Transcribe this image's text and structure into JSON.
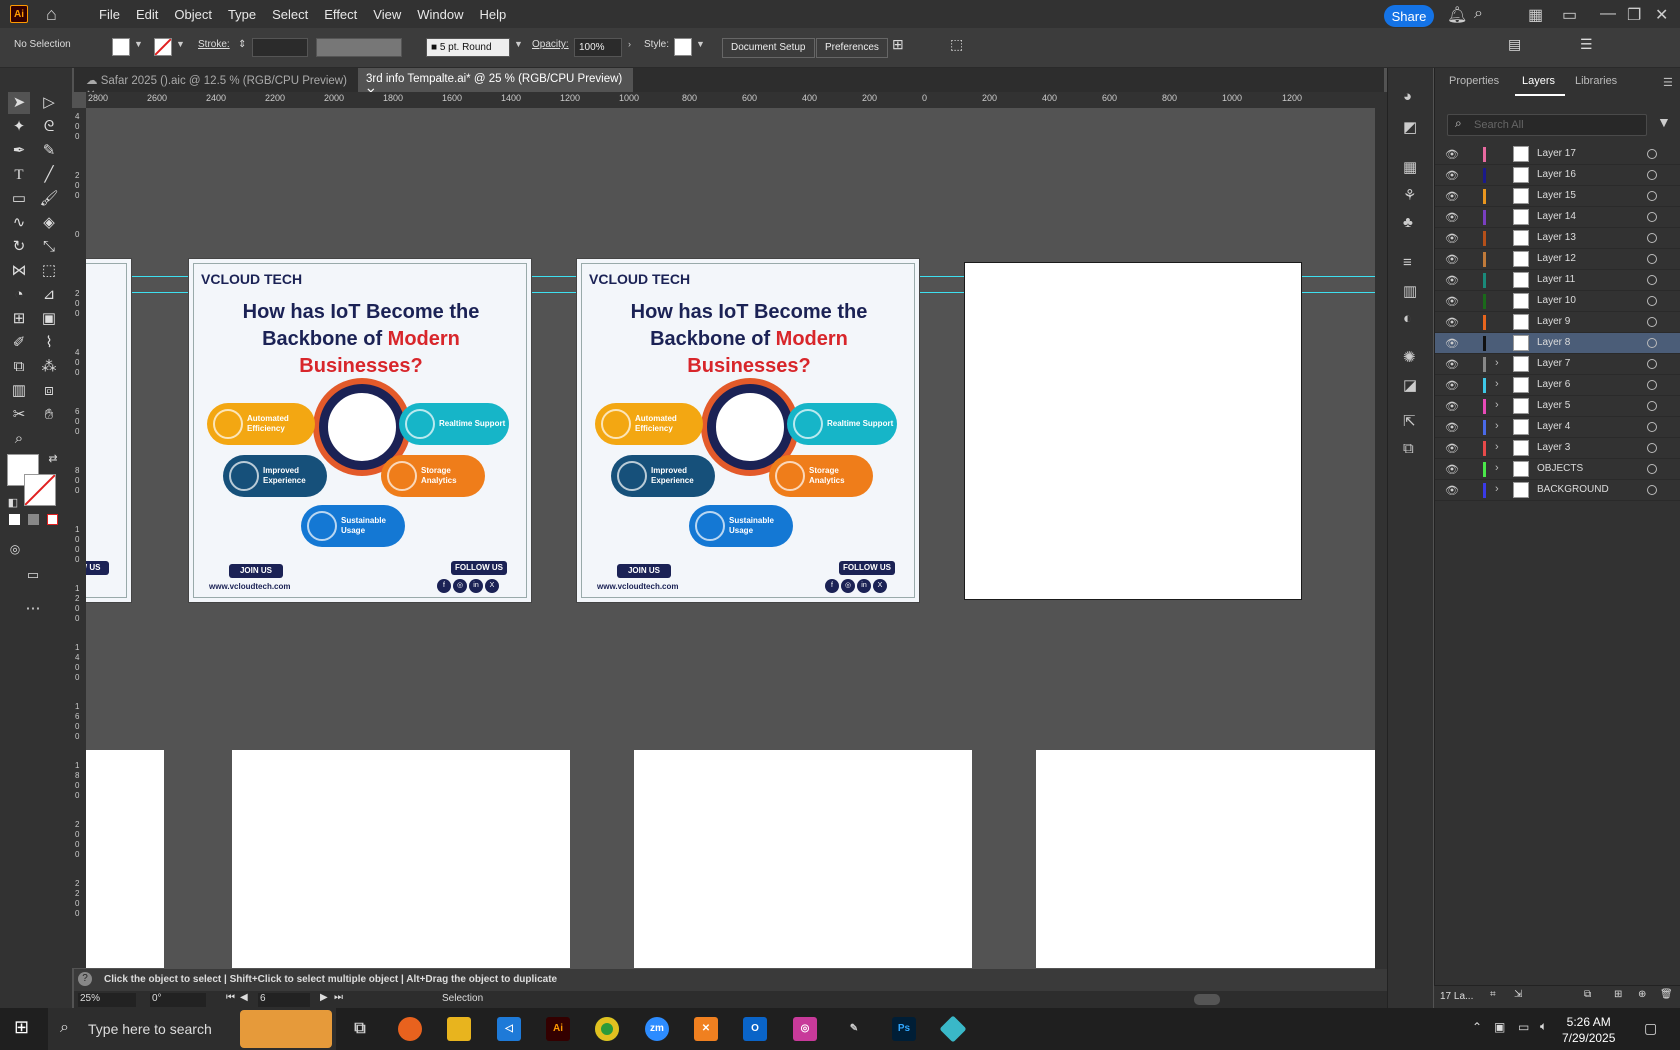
{
  "menubar": {
    "app_icon": "Ai",
    "menus": [
      "File",
      "Edit",
      "Object",
      "Type",
      "Select",
      "Effect",
      "View",
      "Window",
      "Help"
    ],
    "share_label": "Share"
  },
  "control_bar": {
    "selection": "No Selection",
    "stroke_label": "Stroke:",
    "brush": "5 pt. Round",
    "opacity_label": "Opacity:",
    "opacity_value": "100%",
    "style_label": "Style:",
    "document_setup": "Document Setup",
    "preferences": "Preferences"
  },
  "tabs": [
    {
      "label": "Safar 2025 ().aic @ 12.5 % (RGB/CPU Preview)"
    },
    {
      "label": "3rd info Tempalte.ai* @ 25 % (RGB/CPU Preview)"
    }
  ],
  "h_ruler": [
    "2800",
    "2600",
    "2400",
    "2200",
    "2000",
    "1800",
    "1600",
    "1400",
    "1200",
    "1000",
    "800",
    "600",
    "400",
    "200",
    "0",
    "200",
    "400",
    "600",
    "800",
    "1000",
    "1200"
  ],
  "poster": {
    "brand": "VCLOUD TECH",
    "headline_line1": "How has IoT Become the",
    "headline_line2a": "Backbone of ",
    "headline_line2b": "Modern",
    "headline_line3": "Businesses?",
    "pill1": "Automated Efficiency",
    "pill2": "Realtime Support",
    "pill3": "Improved Experience",
    "pill4": "Storage Analytics",
    "pill5": "Sustainable Usage",
    "join_us": "JOIN US",
    "follow_us": "FOLLOW US",
    "url": "www.vcloudtech.com",
    "social": [
      "f",
      "◎",
      "in",
      "X"
    ]
  },
  "left_partial": {
    "follow": "W US"
  },
  "panel": {
    "tabs": [
      "Properties",
      "Layers",
      "Libraries"
    ],
    "search_placeholder": "Search All",
    "layers": [
      {
        "name": "Layer 17",
        "color": "#e86aa0"
      },
      {
        "name": "Layer 16",
        "color": "#1a1a8a"
      },
      {
        "name": "Layer 15",
        "color": "#e8961e"
      },
      {
        "name": "Layer 14",
        "color": "#7a3fc0"
      },
      {
        "name": "Layer 13",
        "color": "#b5501a"
      },
      {
        "name": "Layer 12",
        "color": "#c07a3a"
      },
      {
        "name": "Layer 11",
        "color": "#1a8a7a"
      },
      {
        "name": "Layer 10",
        "color": "#1a6a1a"
      },
      {
        "name": "Layer 9",
        "color": "#e8661e"
      },
      {
        "name": "Layer 8",
        "color": "#111111"
      },
      {
        "name": "Layer 7",
        "color": "#888888"
      },
      {
        "name": "Layer 6",
        "color": "#3ec8e8"
      },
      {
        "name": "Layer 5",
        "color": "#e84ab8"
      },
      {
        "name": "Layer 4",
        "color": "#4a6ae8"
      },
      {
        "name": "Layer 3",
        "color": "#e84a4a"
      },
      {
        "name": "OBJECTS",
        "color": "#4ae84a"
      },
      {
        "name": "BACKGROUND",
        "color": "#3a3ae8"
      }
    ],
    "footer_count": "17 La..."
  },
  "status": {
    "hint": "Click the object to select  |  Shift+Click to select multiple object  |  Alt+Drag the object to duplicate",
    "zoom": "25%",
    "rotation": "0°",
    "artboard": "6",
    "mode": "Selection"
  },
  "taskbar": {
    "search_placeholder": "Type here to search",
    "time": "5:26 AM",
    "date": "7/29/2025"
  }
}
